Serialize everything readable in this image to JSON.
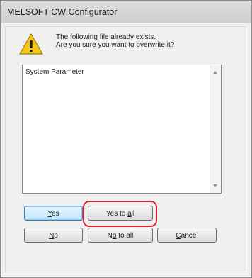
{
  "window": {
    "title": "MELSOFT CW Configurator"
  },
  "dialog": {
    "icon": "warning-icon",
    "message_line1": "The following file already exists.",
    "message_line2": "Are you sure you want to overwrite it?",
    "file_list": [
      "System Parameter"
    ],
    "buttons": {
      "yes": {
        "pre": "",
        "mnemonic": "Y",
        "post": "es"
      },
      "yes_to_all": {
        "pre": "Yes to ",
        "mnemonic": "a",
        "post": "ll"
      },
      "no": {
        "pre": "",
        "mnemonic": "N",
        "post": "o"
      },
      "no_to_all": {
        "pre": "N",
        "mnemonic": "o",
        "post": " to all"
      },
      "cancel": {
        "pre": "",
        "mnemonic": "C",
        "post": "ancel"
      }
    }
  },
  "colors": {
    "highlight": "#e0202a",
    "warning_fill": "#f5c518"
  }
}
